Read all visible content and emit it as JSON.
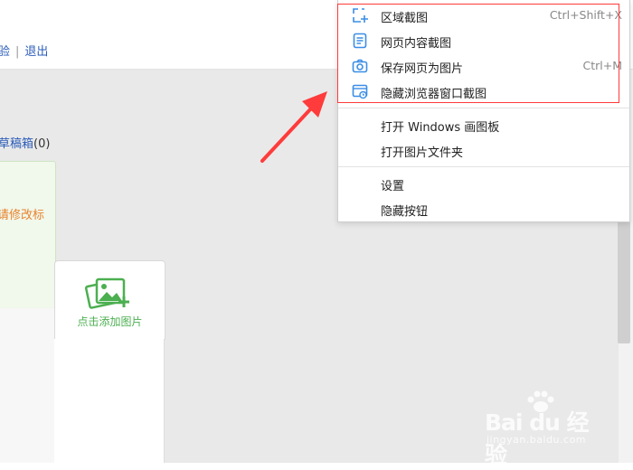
{
  "header": {
    "links": [
      {
        "label": "验"
      },
      {
        "label": "退出"
      }
    ]
  },
  "sidebar": {
    "drafts_label": "草稿箱",
    "drafts_count": "(0)",
    "notice_text": "请修改标"
  },
  "upload": {
    "label": "点击添加图片",
    "icon": "image-add-icon"
  },
  "context_menu": {
    "groups": [
      [
        {
          "label": "区域截图",
          "shortcut": "Ctrl+Shift+X",
          "icon": "region-capture-icon"
        },
        {
          "label": "网页内容截图",
          "shortcut": "",
          "icon": "page-content-capture-icon"
        },
        {
          "label": "保存网页为图片",
          "shortcut": "Ctrl+M",
          "icon": "camera-icon"
        },
        {
          "label": "隐藏浏览器窗口截图",
          "shortcut": "",
          "icon": "hide-window-capture-icon"
        }
      ],
      [
        {
          "label": "打开 Windows 画图板"
        },
        {
          "label": "打开图片文件夹"
        }
      ],
      [
        {
          "label": "设置"
        },
        {
          "label": "隐藏按钮"
        }
      ]
    ]
  },
  "watermark": {
    "brand": "Bai du 经验",
    "url": "jingyan.baidu.com"
  },
  "colors": {
    "accent_blue": "#3a8ee6",
    "link_blue": "#2b5cb8",
    "highlight_red": "#ff3b3b",
    "upload_green": "#4caf50",
    "notice_orange": "#e8842e"
  }
}
